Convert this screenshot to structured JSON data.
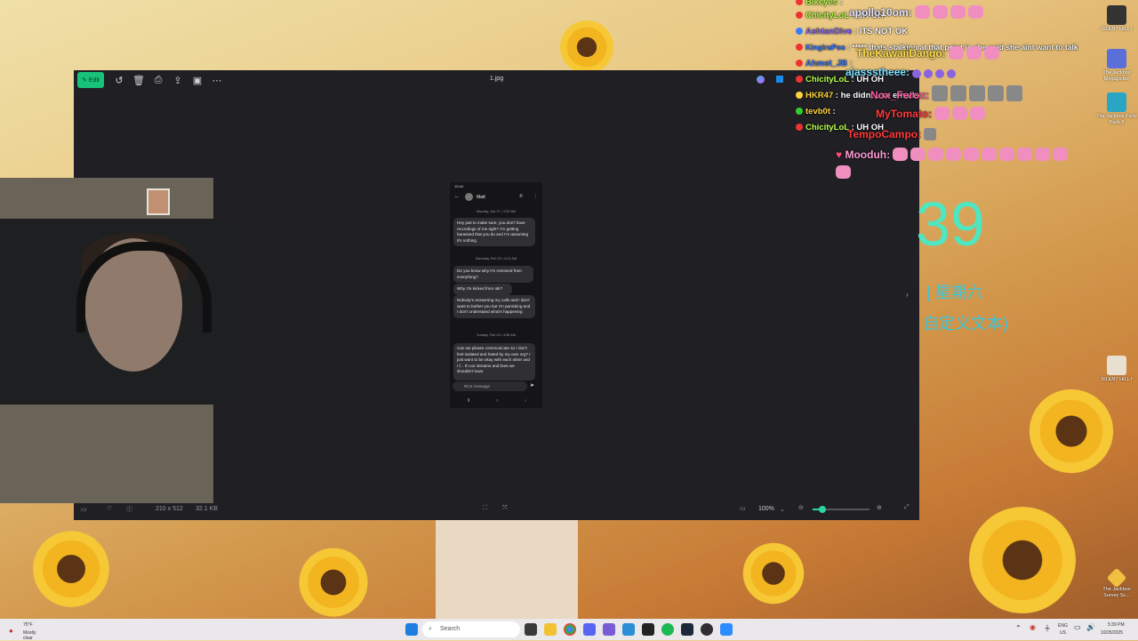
{
  "viewer": {
    "file_name": "1.jpg",
    "edit_label": "Edit",
    "dimensions": "210 x 512",
    "file_size": "32.1 KB",
    "zoom": "100%"
  },
  "phone": {
    "status_time": "10:44",
    "contact": "Matt",
    "date1": "Monday, Jan 27 • 2:52 AM",
    "msg1": "Hey just to make sure, you don't have recordings of me right? I'm getting harassed that you do and I'm assuming it's nothing",
    "date2": "Saturday, Feb 22 • 4:01 AM",
    "msg2": "Do you know why I'm removed from everything?",
    "msg3": "Why I'm kicked from otk?",
    "msg4": "Nobody's answering my calls and I don't want to bother you but I'm panicking and I don't understand what's happening",
    "date3": "Sunday, Feb 23 • 3:56 AM",
    "msg5": "Can we please communicate so I don't feel isolated and hated by my own org? I just want to be okay with each other and I f... th our streams and lives we shouldn't have",
    "input_placeholder": "RCS message"
  },
  "chat": {
    "lines": [
      {
        "user": "Bikeyes",
        "text": ":",
        "color": "#b8ff4c"
      },
      {
        "user": "ChicityLoL",
        "text": ": UH OH",
        "color": "#b8ff4c"
      },
      {
        "user": "AshtanDive",
        "text": ": ITS NOT OK",
        "color": "#8c6cff"
      },
      {
        "user": "KingiraPos",
        "text": ": ***** thats stalking at that point is she said she aint want to talk",
        "color": "#3d7bff"
      },
      {
        "user": "Ahmet_JB",
        "text": ":",
        "color": "#3d7bff"
      },
      {
        "user": "ChicityLoL",
        "text": ": UH OH",
        "color": "#b8ff4c"
      },
      {
        "user": "HKR47",
        "text": ": he didnt use emails",
        "color": "#ffd43b"
      },
      {
        "user": "tevb0t",
        "text": ":",
        "color": "#ffd43b"
      },
      {
        "user": "ChicityLoL",
        "text": ": UH OH",
        "color": "#b8ff4c"
      }
    ],
    "overlay": [
      {
        "user": "apollo10om:",
        "color": "#e8e8ff"
      },
      {
        "user": "TheKawaiiDango:",
        "color": "#ffe14d"
      },
      {
        "user": "ajassstheee:",
        "color": "#7ee0ff"
      },
      {
        "user": "Nox_Ferox:",
        "color": "#ff5aa5"
      },
      {
        "user": "MyTomato:",
        "color": "#ff3b3b"
      },
      {
        "user": "TempoCampo:",
        "color": "#ff3b3b"
      },
      {
        "user": "Mooduh:",
        "color": "#ff9ad6"
      }
    ]
  },
  "clock": {
    "time": "39",
    "day": "| 星期六",
    "custom": "自定义文本)"
  },
  "desktop_icons": [
    {
      "label": "SILENT HILL f"
    },
    {
      "label": "The Jackbox Megapicker"
    },
    {
      "label": "The Jackbox Party Pack 8"
    },
    {
      "label": "SILENT HILL f"
    },
    {
      "label": "The Jackbox Survey Sc..."
    }
  ],
  "taskbar": {
    "weather_temp": "75°F",
    "weather_desc": "Mostly clear",
    "search_placeholder": "Search",
    "lang": "ENG",
    "region": "US",
    "time": "5:39 PM",
    "date": "10/25/2025"
  },
  "colors": {
    "accent": "#18c27a",
    "viewer_bg": "#1f1f24",
    "clock": "#4fe6c2"
  }
}
